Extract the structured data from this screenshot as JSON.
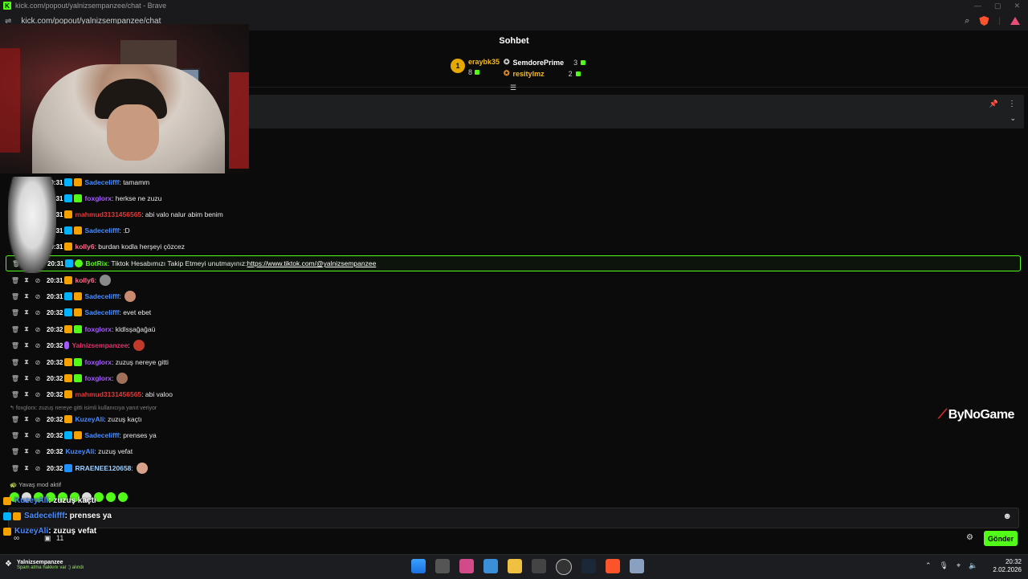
{
  "browser": {
    "title": "kick.com/popout/yalnizsempanzee/chat - Brave",
    "url": "kick.com/popout/yalnizsempanzee/chat"
  },
  "chat": {
    "header": "Sohbet",
    "leaderboard": {
      "first": {
        "rank": "1",
        "name": "eraybk35",
        "count": "8"
      },
      "second": {
        "name": "SemdorePrime",
        "count": "3"
      },
      "third": {
        "name": "resitylmz",
        "count": "2"
      }
    },
    "messages": [
      {
        "time": "20:31",
        "user": "Sadecelifff",
        "text": ": tamamm",
        "color": "#4a8cff"
      },
      {
        "time": "20:31",
        "user": "foxglorx",
        "text": ": herkse ne zuzu",
        "color": "#a45bff"
      },
      {
        "time": "20:31",
        "user": "mahmud3131456565",
        "text": ": abi valo nalur abim benim",
        "color": "#e23a3a"
      },
      {
        "time": "20:31",
        "user": "Sadecelifff",
        "text": ": :D",
        "color": "#4a8cff"
      },
      {
        "time": "20:31",
        "user": "kolly6",
        "text": ": burdan kodla herşeyi çözcez",
        "color": "#ff6b8a"
      },
      {
        "time": "20:31",
        "user": "BotRix",
        "text": ": Tiktok Hesabımızı Takip Etmeyi unutmayınız: ",
        "link": "https://www.tiktok.com/@yalnizsempanzee",
        "color": "#53fc18"
      },
      {
        "time": "20:31",
        "user": "kolly6",
        "text": ": ",
        "color": "#ff6b8a"
      },
      {
        "time": "20:31",
        "user": "Sadecelifff",
        "text": ": ",
        "color": "#4a8cff"
      },
      {
        "time": "20:32",
        "user": "Sadecelifff",
        "text": ": evet ebet",
        "color": "#4a8cff"
      },
      {
        "time": "20:32",
        "user": "foxglorx",
        "text": ": kldlsşağağaü",
        "color": "#a45bff"
      },
      {
        "time": "20:32",
        "user": "Yalnizsempanzee",
        "text": ": ",
        "color": "#e0336a"
      },
      {
        "time": "20:32",
        "user": "foxglorx",
        "text": ": zuzuş nereye gitti",
        "color": "#a45bff"
      },
      {
        "time": "20:32",
        "user": "foxglorx",
        "text": ": ",
        "color": "#a45bff"
      },
      {
        "time": "20:32",
        "user": "mahmud3131456565",
        "text": ": abi valoo",
        "color": "#e23a3a"
      },
      {
        "time": "20:32",
        "user": "KuzeyAli",
        "text": ": zuzuş kaçtı",
        "color": "#4a8cff"
      },
      {
        "time": "20:32",
        "user": "Sadecelifff",
        "text": ": prenses ya",
        "color": "#4a8cff"
      },
      {
        "time": "20:32",
        "user": "KuzeyAli",
        "text": ": zuzuş vefat",
        "color": "#4a8cff"
      },
      {
        "time": "20:32",
        "user": "RRAENEE120658",
        "text": ": ",
        "color": "#9fd0ff"
      }
    ],
    "reply_note": "foxglorx: zuzuş nereye gitti isimli kullanıcıya yanıt veriyor",
    "slow_mode": "Yavaş mod aktif",
    "overlay": [
      {
        "user": "KuzeyAli",
        "text": ": zuzuş kaçtı"
      },
      {
        "user": "Sadecelifff",
        "text": ": prenses ya"
      },
      {
        "user": "KuzeyAli",
        "text": ": zuzuş vefat"
      }
    ],
    "viewer_count": "11",
    "send_label": "Gönder"
  },
  "watermark": "ByNoGame",
  "taskbar": {
    "notif_title": "Yalnizsempanzee",
    "notif_sub": "Spam atma hakkını var :) alındı",
    "time": "20:32",
    "date": "2.02.2026"
  },
  "colors": {
    "accent": "#53fc18",
    "bg": "#0b0b0c"
  }
}
